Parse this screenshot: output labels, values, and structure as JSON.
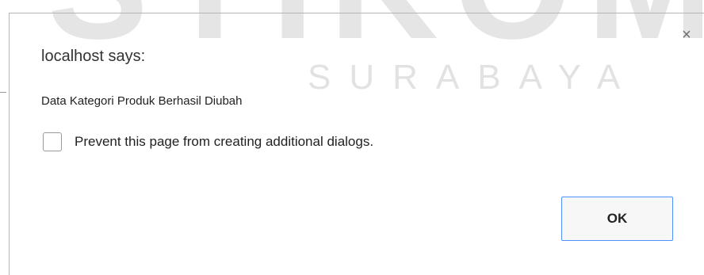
{
  "watermark": {
    "brand": "STIKOM",
    "city": "SURABAYA"
  },
  "dialog": {
    "title": "localhost says:",
    "message": "Data Kategori Produk Berhasil Diubah",
    "checkbox_label": "Prevent this page from creating additional dialogs.",
    "checkbox_checked": false,
    "ok_label": "OK",
    "close_glyph": "×"
  },
  "colors": {
    "ok_border": "#4d90fe",
    "watermark": "#d0d0d0"
  }
}
